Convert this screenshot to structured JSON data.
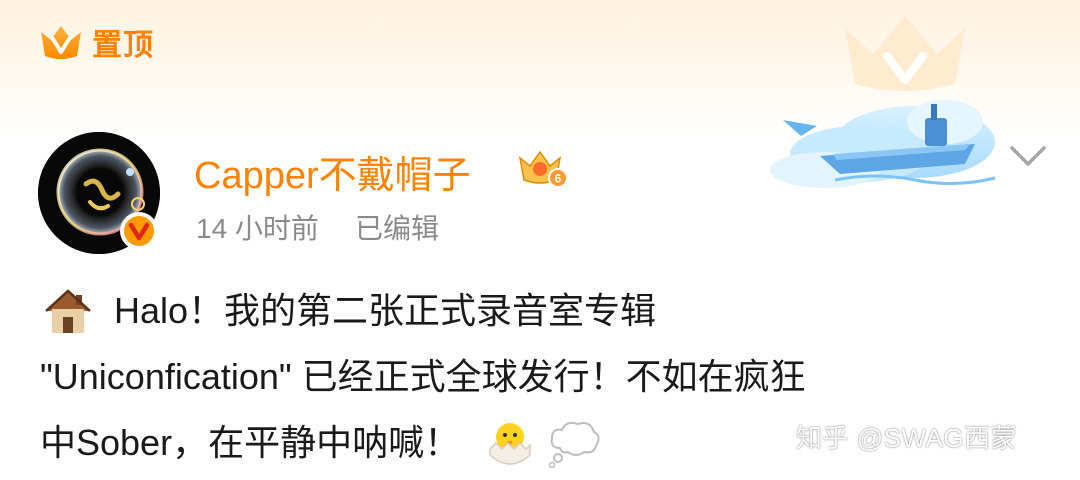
{
  "header": {
    "pin_icon": "v-crown-icon",
    "pin_label": "置顶"
  },
  "author": {
    "name": "Capper不戴帽子",
    "verified_icon": "verified-v-badge-icon",
    "member_badge_icon": "member-crown-badge-icon",
    "member_level": "6"
  },
  "meta": {
    "time": "14 小时前",
    "edited": "已编辑"
  },
  "post": {
    "line1": "Halo！我的第二张正式录音室专辑",
    "line2": "\"Uniconfication\" 已经正式全球发行！不如在疯狂",
    "line3": "中Sober，在平静中呐喊！",
    "emojis": [
      "house-emoji",
      "hatching-chick-emoji",
      "thought-bubble-emoji"
    ]
  },
  "watermark": "知乎 @SWAG西蒙",
  "colors": {
    "accent": "#ff8200",
    "meta_gray": "#8a8a8a",
    "text": "#1a1a1a"
  }
}
